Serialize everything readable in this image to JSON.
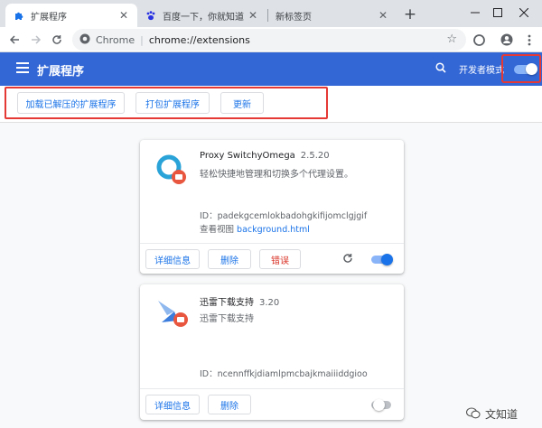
{
  "tabs": [
    {
      "title": "扩展程序",
      "icon": "puzzle-icon",
      "active": true
    },
    {
      "title": "百度一下，你就知道",
      "icon": "baidu-paw-icon",
      "active": false
    },
    {
      "title": "新标签页",
      "icon": "none",
      "active": false
    }
  ],
  "new_tab_label": "+",
  "omnibox": {
    "chrome_label": "Chrome",
    "separator": "|",
    "url": "chrome://extensions"
  },
  "header": {
    "title": "扩展程序",
    "developer_mode_label": "开发者模式",
    "developer_mode_on": true
  },
  "dev_actions": {
    "load_unpacked": "加载已解压的扩展程序",
    "pack_extension": "打包扩展程序",
    "update": "更新"
  },
  "extensions": [
    {
      "name": "Proxy SwitchyOmega",
      "version": "2.5.20",
      "description": "轻松快捷地管理和切换多个代理设置。",
      "id_line": "ID：padekgcemlokbadohgkifijomclgjgif",
      "views_label": "查看视图",
      "views_link": "background.html",
      "details_label": "详细信息",
      "remove_label": "删除",
      "errors_label": "错误",
      "enabled": true
    },
    {
      "name": "迅雷下载支持",
      "version": "3.20",
      "description": "迅雷下载支持",
      "id_line": "ID：ncennffkjdiamlpmcbajkmaiiiddgioo",
      "details_label": "详细信息",
      "remove_label": "删除",
      "enabled": false
    }
  ],
  "watermark": "文知道",
  "colors": {
    "header_blue": "#3367d6",
    "link_blue": "#1a73e8",
    "error_red": "#d93025",
    "highlight_red": "#e53935"
  }
}
